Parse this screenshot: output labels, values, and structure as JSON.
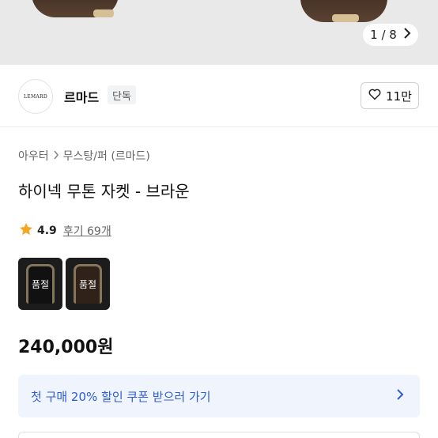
{
  "hero": {
    "counter": "1 / 8",
    "next_icon": "chevron-right-icon"
  },
  "store": {
    "logo_text": "LEMARD",
    "name": "르마드",
    "badge": "단독",
    "like_icon": "heart-outline-icon",
    "like_count": "11만"
  },
  "breadcrumb": {
    "items": [
      "아우터",
      "무스탕/퍼 (르마드)"
    ],
    "separator_icon": "chevron-right-icon"
  },
  "product": {
    "title": "하이넥 무톤 자켓 - 브라운",
    "rating": "4.9",
    "rating_icon": "star-icon",
    "reviews": "후기 69개",
    "thumbnails": [
      {
        "label": "품절",
        "color": "#1b1b1b"
      },
      {
        "label": "품절",
        "color": "#4b3527"
      }
    ],
    "price": "240,000원"
  },
  "coupon": {
    "text": "첫 구매 20% 할인 쿠폰 받으러 가기",
    "icon": "chevron-right-icon"
  },
  "colors": {
    "accent": "#2e5bd8",
    "coupon_bg": "#f0f4fd",
    "star": "#f5a623"
  }
}
